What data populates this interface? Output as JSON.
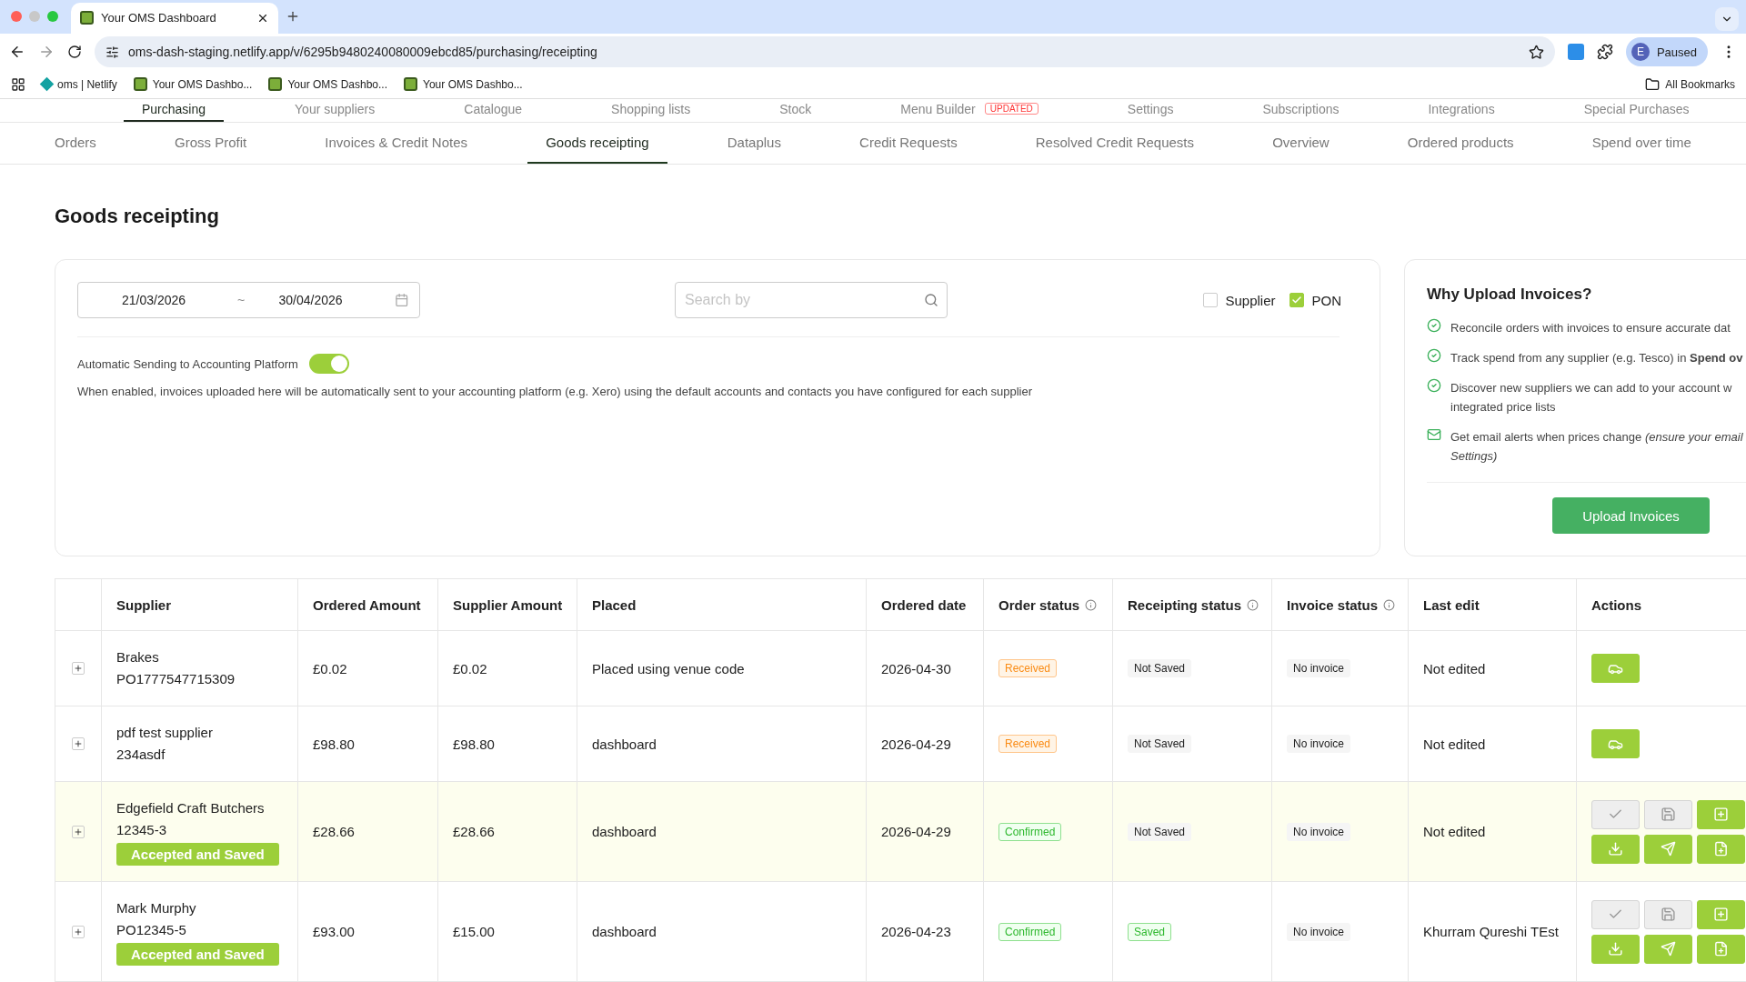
{
  "browser": {
    "tab_title": "Your OMS Dashboard",
    "url": "oms-dash-staging.netlify.app/v/6295b9480240080009ebcd85/purchasing/receipting",
    "profile_initial": "E",
    "profile_status": "Paused",
    "bookmarks": [
      "oms | Netlify",
      "Your OMS Dashbo...",
      "Your OMS Dashbo...",
      "Your OMS Dashbo..."
    ],
    "all_bookmarks": "All Bookmarks"
  },
  "top_nav": [
    {
      "label": "Purchasing",
      "selected": true
    },
    {
      "label": "Your suppliers",
      "selected": false
    },
    {
      "label": "Catalogue",
      "selected": false
    },
    {
      "label": "Shopping lists",
      "selected": false
    },
    {
      "label": "Stock",
      "selected": false
    },
    {
      "label": "Menu Builder",
      "badge": "UPDATED",
      "selected": false
    },
    {
      "label": "Settings",
      "selected": false
    },
    {
      "label": "Subscriptions",
      "selected": false
    },
    {
      "label": "Integrations",
      "selected": false
    },
    {
      "label": "Special Purchases",
      "selected": false
    }
  ],
  "sub_tabs": [
    {
      "label": "Orders",
      "selected": false
    },
    {
      "label": "Gross Profit",
      "selected": false
    },
    {
      "label": "Invoices & Credit Notes",
      "selected": false
    },
    {
      "label": "Goods receipting",
      "selected": true
    },
    {
      "label": "Dataplus",
      "selected": false
    },
    {
      "label": "Credit Requests",
      "selected": false
    },
    {
      "label": "Resolved Credit Requests",
      "selected": false
    },
    {
      "label": "Overview",
      "selected": false
    },
    {
      "label": "Ordered products",
      "selected": false
    },
    {
      "label": "Spend over time",
      "selected": false
    }
  ],
  "page_title": "Goods receipting",
  "filters": {
    "date_from": "21/03/2026",
    "date_separator": "~",
    "date_to": "30/04/2026",
    "search": {
      "placeholder": "Search by"
    },
    "checkboxes": [
      {
        "label": "Supplier",
        "checked": false
      },
      {
        "label": "PON",
        "checked": true
      }
    ],
    "auto_send": {
      "label": "Automatic Sending to Accounting Platform",
      "on": true,
      "description": "When enabled, invoices uploaded here will be automatically sent to your accounting platform (e.g. Xero) using the default accounts and contacts you have configured for each supplier"
    }
  },
  "why_upload": {
    "title": "Why Upload Invoices?",
    "items": [
      {
        "kind": "check",
        "lines": [
          "Reconcile orders with invoices to ensure accurate dat"
        ]
      },
      {
        "kind": "check",
        "lines": [
          "Track spend from any supplier (e.g. Tesco) in **Spend ov**"
        ]
      },
      {
        "kind": "check",
        "lines": [
          "Discover new suppliers we can add to your account w",
          "integrated price lists"
        ]
      },
      {
        "kind": "mail",
        "lines": [
          "Get email alerts when prices change *(ensure your email*",
          "*Settings)*"
        ]
      }
    ],
    "button": "Upload Invoices"
  },
  "table": {
    "columns": [
      {
        "label": "Supplier",
        "info": false
      },
      {
        "label": "Ordered Amount",
        "info": false
      },
      {
        "label": "Supplier Amount",
        "info": false
      },
      {
        "label": "Placed",
        "info": false
      },
      {
        "label": "Ordered date",
        "info": false
      },
      {
        "label": "Order status",
        "info": true
      },
      {
        "label": "Receipting status",
        "info": true
      },
      {
        "label": "Invoice status",
        "info": true
      },
      {
        "label": "Last edit",
        "info": false
      },
      {
        "label": "Actions",
        "info": false
      }
    ],
    "rows": [
      {
        "highlighted": false,
        "supplier": "Brakes",
        "po": "PO1777547715309",
        "ordered_amount": "£0.02",
        "supplier_amount": "£0.02",
        "placed": "Placed using venue code",
        "ordered_date": "2026-04-30",
        "order_status": {
          "kind": "received",
          "label": "Received"
        },
        "receipting_status": {
          "kind": "neutral",
          "label": "Not Saved"
        },
        "invoice_status": "No invoice",
        "last_edit": "Not edited",
        "actions": [
          {
            "kind": "receive",
            "disabled": false
          }
        ]
      },
      {
        "highlighted": false,
        "supplier": "pdf test supplier",
        "po": "234asdf",
        "ordered_amount": "£98.80",
        "supplier_amount": "£98.80",
        "placed": "dashboard",
        "ordered_date": "2026-04-29",
        "order_status": {
          "kind": "received",
          "label": "Received"
        },
        "receipting_status": {
          "kind": "neutral",
          "label": "Not Saved"
        },
        "invoice_status": "No invoice",
        "last_edit": "Not edited",
        "actions": [
          {
            "kind": "receive",
            "disabled": false
          }
        ]
      },
      {
        "highlighted": true,
        "supplier": "Edgefield Craft Butchers",
        "po": "12345-3",
        "badge": "Accepted and Saved",
        "ordered_amount": "£28.66",
        "supplier_amount": "£28.66",
        "placed": "dashboard",
        "ordered_date": "2026-04-29",
        "order_status": {
          "kind": "confirmed",
          "label": "Confirmed"
        },
        "receipting_status": {
          "kind": "neutral",
          "label": "Not Saved"
        },
        "invoice_status": "No invoice",
        "last_edit": "Not edited",
        "actions": [
          {
            "kind": "approve",
            "disabled": true
          },
          {
            "kind": "save",
            "disabled": true
          },
          {
            "kind": "add",
            "disabled": false
          },
          {
            "kind": "download",
            "disabled": false
          },
          {
            "kind": "send",
            "disabled": false
          },
          {
            "kind": "add-file",
            "disabled": false
          }
        ]
      },
      {
        "highlighted": false,
        "supplier": "Mark Murphy",
        "po": "PO12345-5",
        "badge": "Accepted and Saved",
        "ordered_amount": "£93.00",
        "supplier_amount": "£15.00",
        "placed": "dashboard",
        "ordered_date": "2026-04-23",
        "order_status": {
          "kind": "confirmed",
          "label": "Confirmed"
        },
        "receipting_status": {
          "kind": "success",
          "label": "Saved"
        },
        "invoice_status": "No invoice",
        "last_edit": "Khurram Qureshi TEst",
        "actions": [
          {
            "kind": "approve",
            "disabled": true
          },
          {
            "kind": "save",
            "disabled": true
          },
          {
            "kind": "add",
            "disabled": false
          },
          {
            "kind": "download",
            "disabled": false
          },
          {
            "kind": "send",
            "disabled": false
          },
          {
            "kind": "add-file",
            "disabled": false
          }
        ]
      }
    ]
  }
}
